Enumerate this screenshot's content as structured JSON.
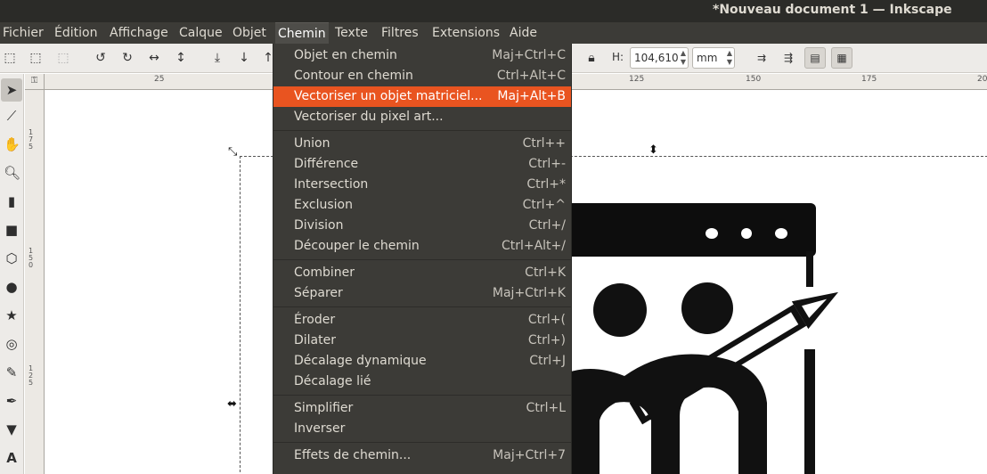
{
  "window": {
    "title": "*Nouveau document 1 — Inkscape"
  },
  "menubar": {
    "items": [
      "Fichier",
      "Édition",
      "Affichage",
      "Calque",
      "Objet",
      "Chemin",
      "Texte",
      "Filtres",
      "Extensions",
      "Aide"
    ],
    "active": "Chemin"
  },
  "toolbar": {
    "h_label": "H:",
    "h_value": "104,610",
    "unit": "mm"
  },
  "ruler": {
    "h_labels": [
      "25",
      "125",
      "150",
      "175",
      "20"
    ],
    "v_labels": [
      "175",
      "150",
      "125"
    ]
  },
  "menu": {
    "groups": [
      [
        {
          "label": "Objet en chemin",
          "shortcut": "Maj+Ctrl+C"
        },
        {
          "label": "Contour en chemin",
          "shortcut": "Ctrl+Alt+C"
        },
        {
          "label": "Vectoriser un objet matriciel...",
          "shortcut": "Maj+Alt+B",
          "highlighted": true
        },
        {
          "label": "Vectoriser du pixel art...",
          "shortcut": ""
        }
      ],
      [
        {
          "label": "Union",
          "shortcut": "Ctrl++"
        },
        {
          "label": "Différence",
          "shortcut": "Ctrl+-"
        },
        {
          "label": "Intersection",
          "shortcut": "Ctrl+*"
        },
        {
          "label": "Exclusion",
          "shortcut": "Ctrl+^"
        },
        {
          "label": "Division",
          "shortcut": "Ctrl+/"
        },
        {
          "label": "Découper le chemin",
          "shortcut": "Ctrl+Alt+/"
        }
      ],
      [
        {
          "label": "Combiner",
          "shortcut": "Ctrl+K"
        },
        {
          "label": "Séparer",
          "shortcut": "Maj+Ctrl+K"
        }
      ],
      [
        {
          "label": "Éroder",
          "shortcut": "Ctrl+("
        },
        {
          "label": "Dilater",
          "shortcut": "Ctrl+)"
        },
        {
          "label": "Décalage dynamique",
          "shortcut": "Ctrl+J"
        },
        {
          "label": "Décalage lié",
          "shortcut": ""
        }
      ],
      [
        {
          "label": "Simplifier",
          "shortcut": "Ctrl+L"
        },
        {
          "label": "Inverser",
          "shortcut": ""
        }
      ],
      [
        {
          "label": "Effets de chemin...",
          "shortcut": "Maj+Ctrl+7"
        }
      ]
    ]
  },
  "colors": {
    "highlight": "#e95420",
    "menu_bg": "#3c3b37",
    "titlebar_bg": "#2b2b28"
  }
}
